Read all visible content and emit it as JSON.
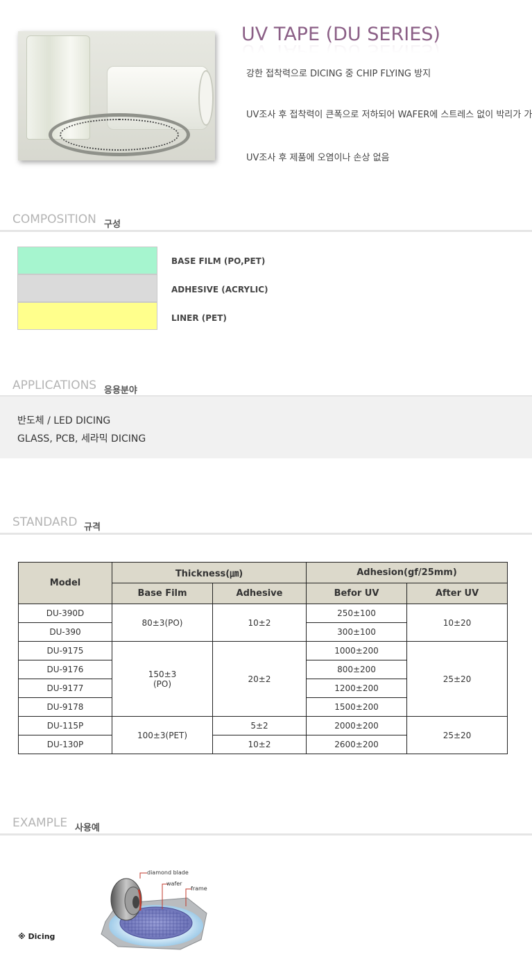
{
  "header": {
    "title": "UV TAPE (DU SERIES)",
    "features": [
      "강한 접착력으로 DICING 중 CHIP FLYING 방지",
      "UV조사 후 접착력이 큰폭으로 저하되어 WAFER에 스트레스 없이 박리가 가능함",
      "UV조사 후 제품에 오염이나 손상 없음"
    ]
  },
  "sections": {
    "composition": {
      "en": "COMPOSITION",
      "ko": "구성"
    },
    "applications": {
      "en": "APPLICATIONS",
      "ko": "응용분야"
    },
    "standard": {
      "en": "STANDARD",
      "ko": "규격"
    },
    "example": {
      "en": "EXAMPLE",
      "ko": "사용예"
    }
  },
  "composition": {
    "layers": [
      {
        "label": "BASE FILM (PO,PET)",
        "color": "#a6f5cf"
      },
      {
        "label": "ADHESIVE (ACRYLIC)",
        "color": "#dadada"
      },
      {
        "label": "LINER (PET)",
        "color": "#ffff8c"
      }
    ]
  },
  "applications": {
    "lines": [
      "반도체 / LED DICING",
      "GLASS, PCB, 세라믹 DICING"
    ]
  },
  "standard": {
    "headers": {
      "model": "Model",
      "thickness": "Thickness(㎛)",
      "adhesion": "Adhesion(gf/25mm)",
      "base_film": "Base Film",
      "adhesive": "Adhesive",
      "before_uv": "Befor UV",
      "after_uv": "After UV"
    },
    "rows": [
      {
        "model": "DU-390D",
        "base_film": "80±3(PO)",
        "adhesive": "10±2",
        "before_uv": "250±100",
        "after_uv": "10±20"
      },
      {
        "model": "DU-390",
        "before_uv": "300±100"
      },
      {
        "model": "DU-9175",
        "base_film_line1": "150±3",
        "base_film_line2": "(PO)",
        "adhesive": "20±2",
        "before_uv": "1000±200",
        "after_uv": "25±20"
      },
      {
        "model": "DU-9176",
        "before_uv": "800±200"
      },
      {
        "model": "DU-9177",
        "before_uv": "1200±200"
      },
      {
        "model": "DU-9178",
        "before_uv": "1500±200"
      },
      {
        "model": "DU-115P",
        "base_film": "100±3(PET)",
        "adhesive": "5±2",
        "before_uv": "2000±200",
        "after_uv": "25±20"
      },
      {
        "model": "DU-130P",
        "adhesive": "10±2",
        "before_uv": "2600±200"
      }
    ]
  },
  "example": {
    "caption": "※ Dicing",
    "callouts": {
      "blade": "diamond blade",
      "wafer": "wafer",
      "frame": "frame"
    }
  }
}
